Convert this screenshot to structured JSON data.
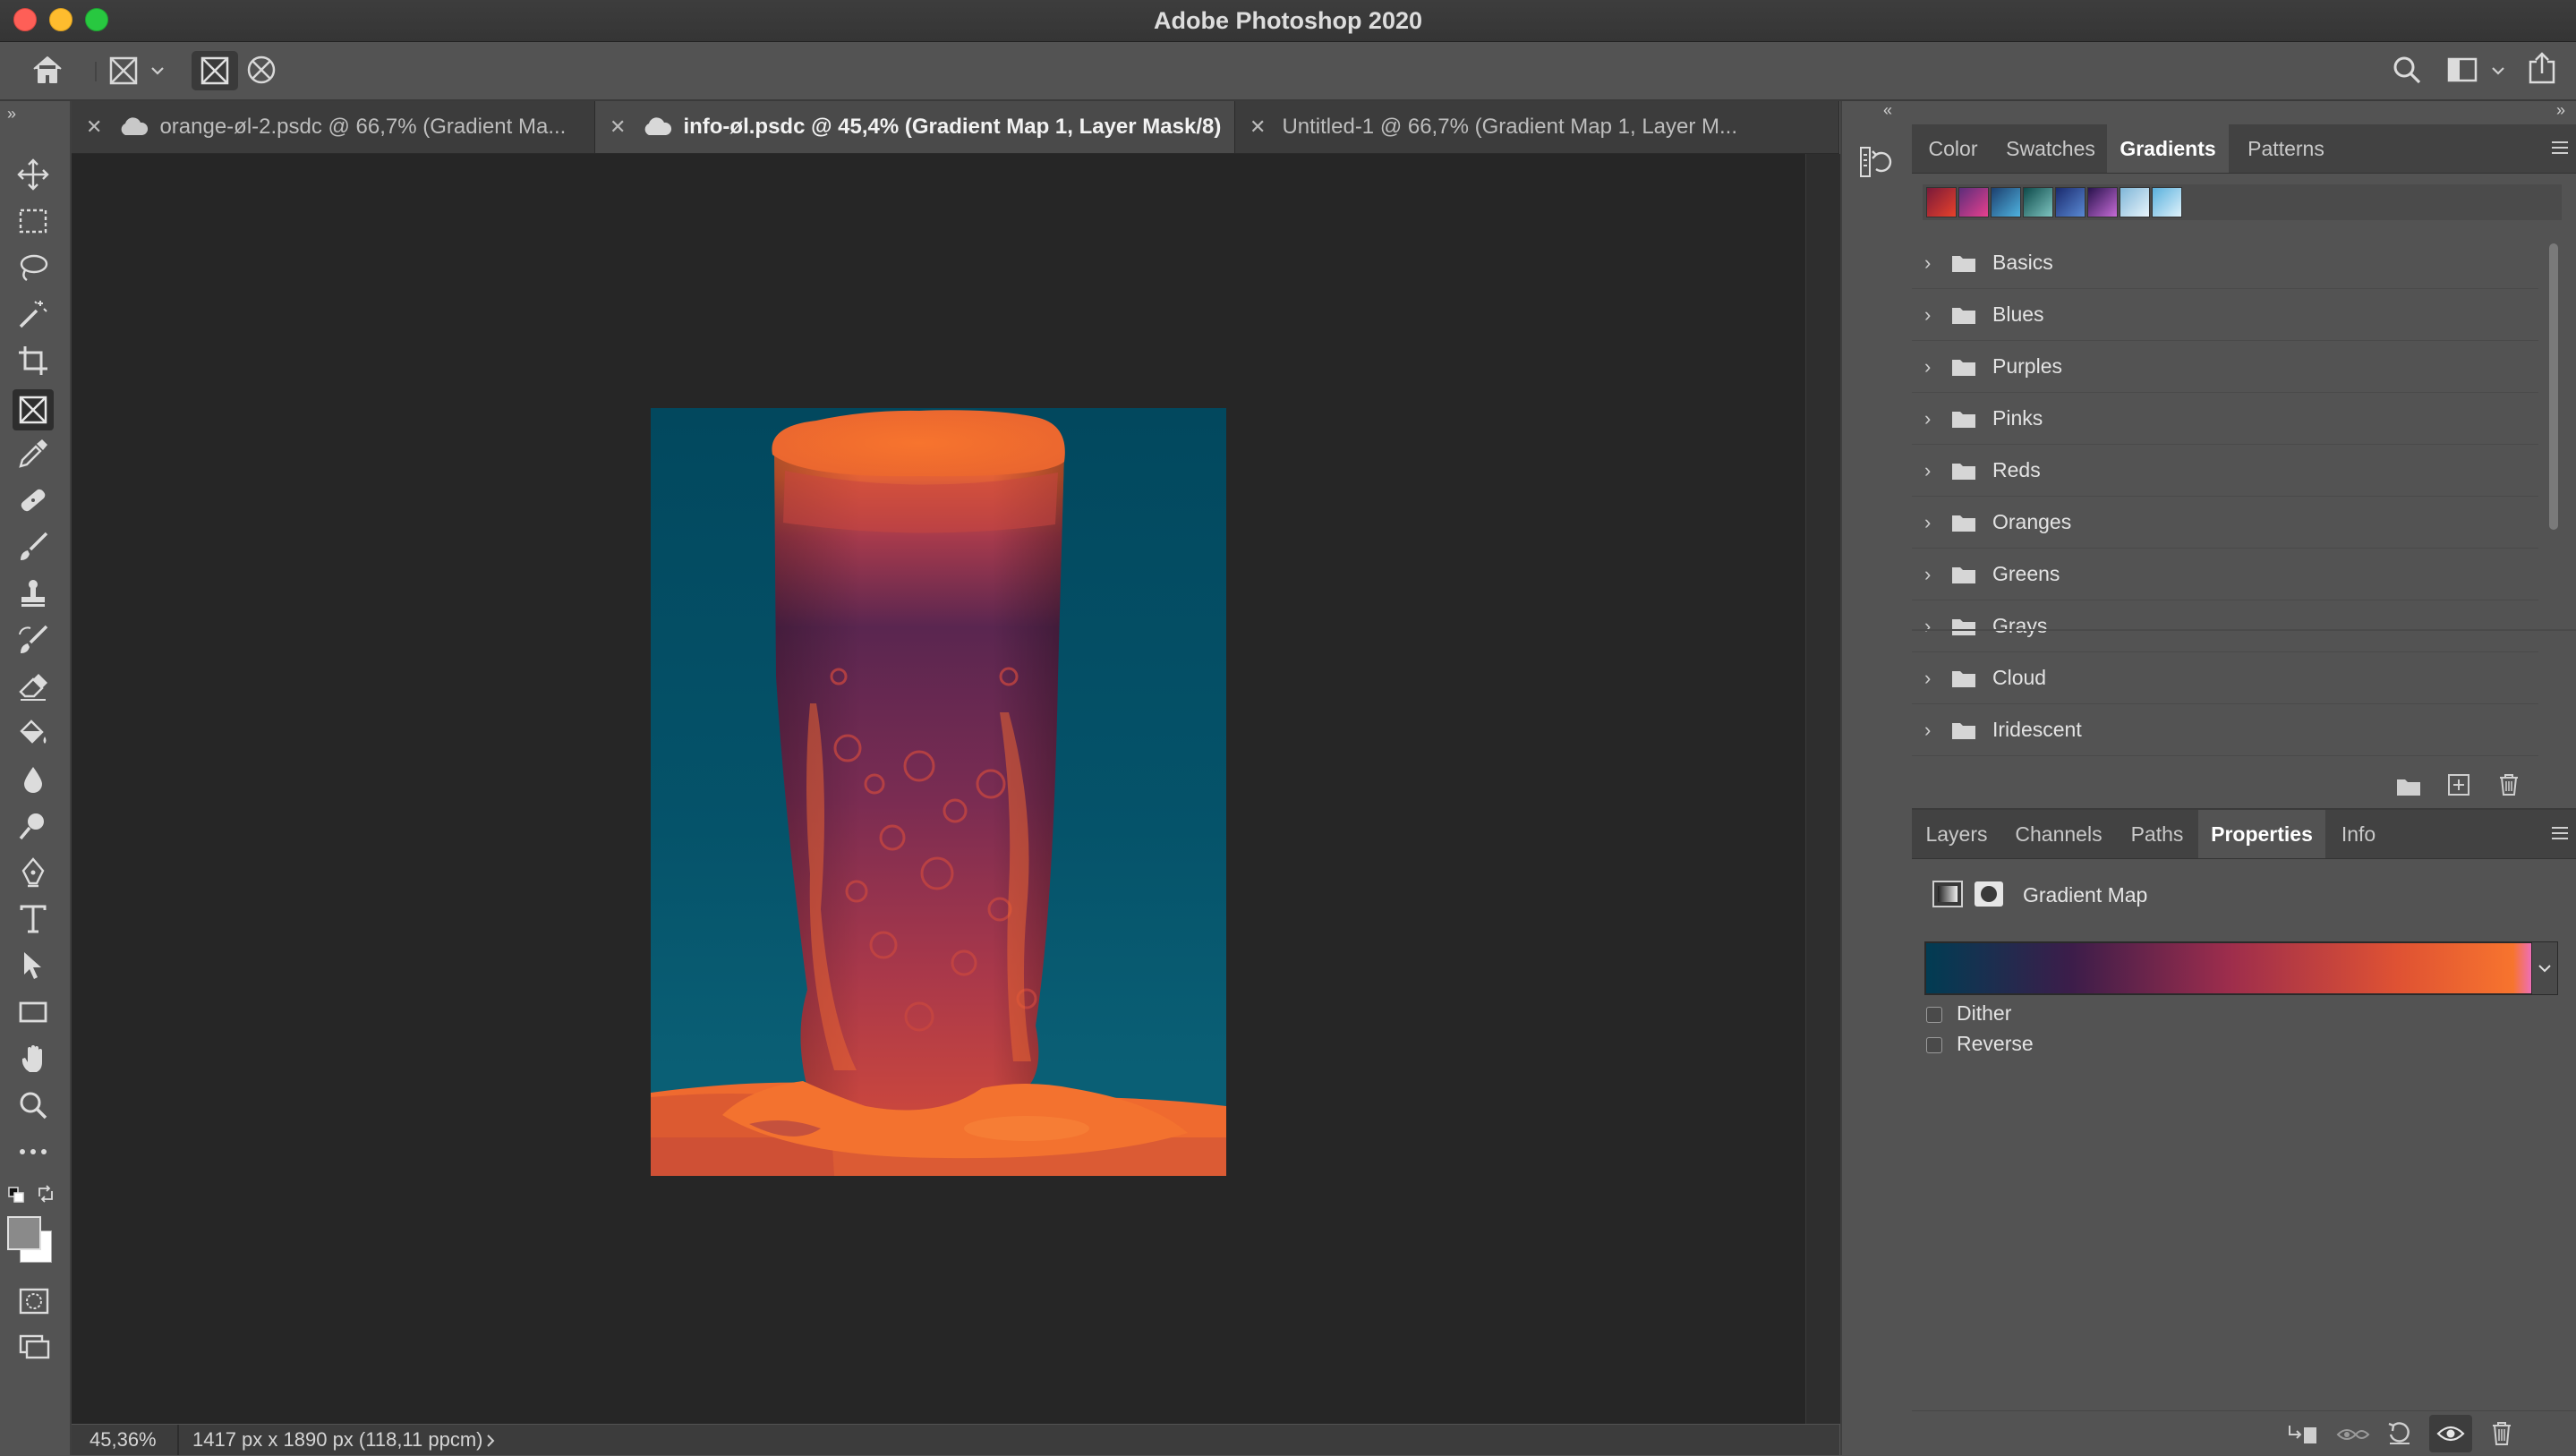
{
  "app": {
    "title": "Adobe Photoshop 2020"
  },
  "tabs": [
    {
      "label": "orange-øl-2.psdc @ 66,7% (Gradient Ma..."
    },
    {
      "label": "info-øl.psdc @ 45,4% (Gradient Map 1, Layer Mask/8)"
    },
    {
      "label": "Untitled-1 @ 66,7% (Gradient Map 1, Layer M..."
    }
  ],
  "status": {
    "zoom": "45,36%",
    "doc_info": "1417 px x 1890 px (118,11 ppcm)"
  },
  "top_panel": {
    "tabs": [
      "Color",
      "Swatches",
      "Gradients",
      "Patterns"
    ],
    "active_tab": "Gradients",
    "gradient_presets": [
      [
        "#7a1a3a",
        "#e8412b"
      ],
      [
        "#5c2d7a",
        "#e6408e"
      ],
      [
        "#1c3f6e",
        "#4fb3e0"
      ],
      [
        "#0d4a4a",
        "#7ec4c0"
      ],
      [
        "#1a2a6e",
        "#5a8ad4"
      ],
      [
        "#28134d",
        "#c56bd6"
      ],
      [
        "#7fb6d8",
        "#e8f4fb"
      ],
      [
        "#59b0dd",
        "#dff2fb"
      ]
    ],
    "folders": [
      "Basics",
      "Blues",
      "Purples",
      "Pinks",
      "Reds",
      "Oranges",
      "Greens",
      "Grays",
      "Cloud",
      "Iridescent"
    ]
  },
  "bottom_panel": {
    "tabs": [
      "Layers",
      "Channels",
      "Paths",
      "Properties",
      "Info"
    ],
    "active_tab": "Properties",
    "adjustment_title": "Gradient Map",
    "gradient_colors": [
      "#013c53",
      "#3c1d4a",
      "#9d2d4c",
      "#df5233",
      "#f7742e",
      "#ee6fb5"
    ],
    "options": [
      {
        "label": "Dither",
        "checked": false
      },
      {
        "label": "Reverse",
        "checked": false
      }
    ]
  },
  "colors": {
    "foreground": "#8a8a8a",
    "background": "#ffffff"
  }
}
